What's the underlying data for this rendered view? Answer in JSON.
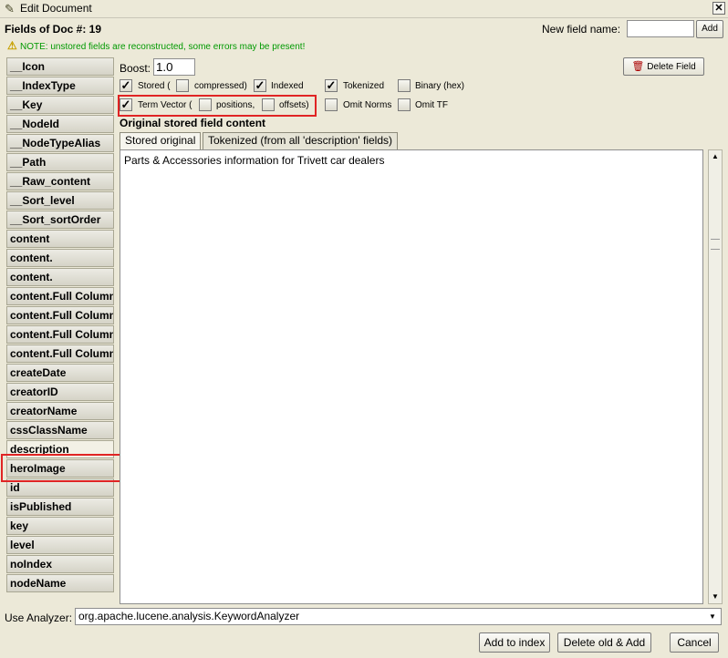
{
  "window": {
    "title": "Edit Document",
    "close_glyph": "✕"
  },
  "heading": "Fields of Doc #: 19",
  "note": "NOTE: unstored fields are reconstructed, some errors may be present!",
  "new_field": {
    "label": "New field name:",
    "value": "",
    "add_label": "Add"
  },
  "fields": [
    "__Icon",
    "__IndexType",
    "__Key",
    "__NodeId",
    "__NodeTypeAlias",
    "__Path",
    "__Raw_content",
    "__Sort_level",
    "__Sort_sortOrder",
    "content",
    "content.",
    "content.",
    "content.Full Column",
    "content.Full Column",
    "content.Full Column",
    "content.Full Column",
    "createDate",
    "creatorID",
    "creatorName",
    "cssClassName",
    "description",
    "heroImage",
    "id",
    "isPublished",
    "key",
    "level",
    "noIndex",
    "nodeName"
  ],
  "selected_field": "description",
  "boost": {
    "label": "Boost:",
    "value": "1.0"
  },
  "delete_field_label": "Delete Field",
  "options_row1": {
    "stored": {
      "label": "Stored (",
      "checked": true
    },
    "compressed": {
      "label": "compressed)",
      "checked": false
    },
    "indexed": {
      "label": "Indexed",
      "checked": true
    },
    "tokenized": {
      "label": "Tokenized",
      "checked": true
    },
    "binary": {
      "label": "Binary (hex)",
      "checked": false
    }
  },
  "options_row2": {
    "term_vector": {
      "label": "Term Vector (",
      "checked": true
    },
    "positions": {
      "label": "positions,",
      "checked": false
    },
    "offsets": {
      "label": "offsets)",
      "checked": false
    },
    "omit_norms": {
      "label": "Omit Norms",
      "checked": false
    },
    "omit_tf": {
      "label": "Omit TF",
      "checked": false
    }
  },
  "content_section_title": "Original stored field content",
  "tabs": [
    {
      "label": "Stored original",
      "active": true
    },
    {
      "label": "Tokenized (from all 'description' fields)",
      "active": false
    }
  ],
  "content_text": "Parts & Accessories information for Trivett car dealers",
  "analyzer": {
    "label": "Use Analyzer:",
    "value": "org.apache.lucene.analysis.KeywordAnalyzer"
  },
  "buttons": {
    "add_to_index": "Add to index",
    "delete_old_add": "Delete old & Add",
    "cancel": "Cancel"
  },
  "icons": {
    "app": "document-edit-icon",
    "warning": "warning-icon",
    "delete": "trash-icon"
  }
}
